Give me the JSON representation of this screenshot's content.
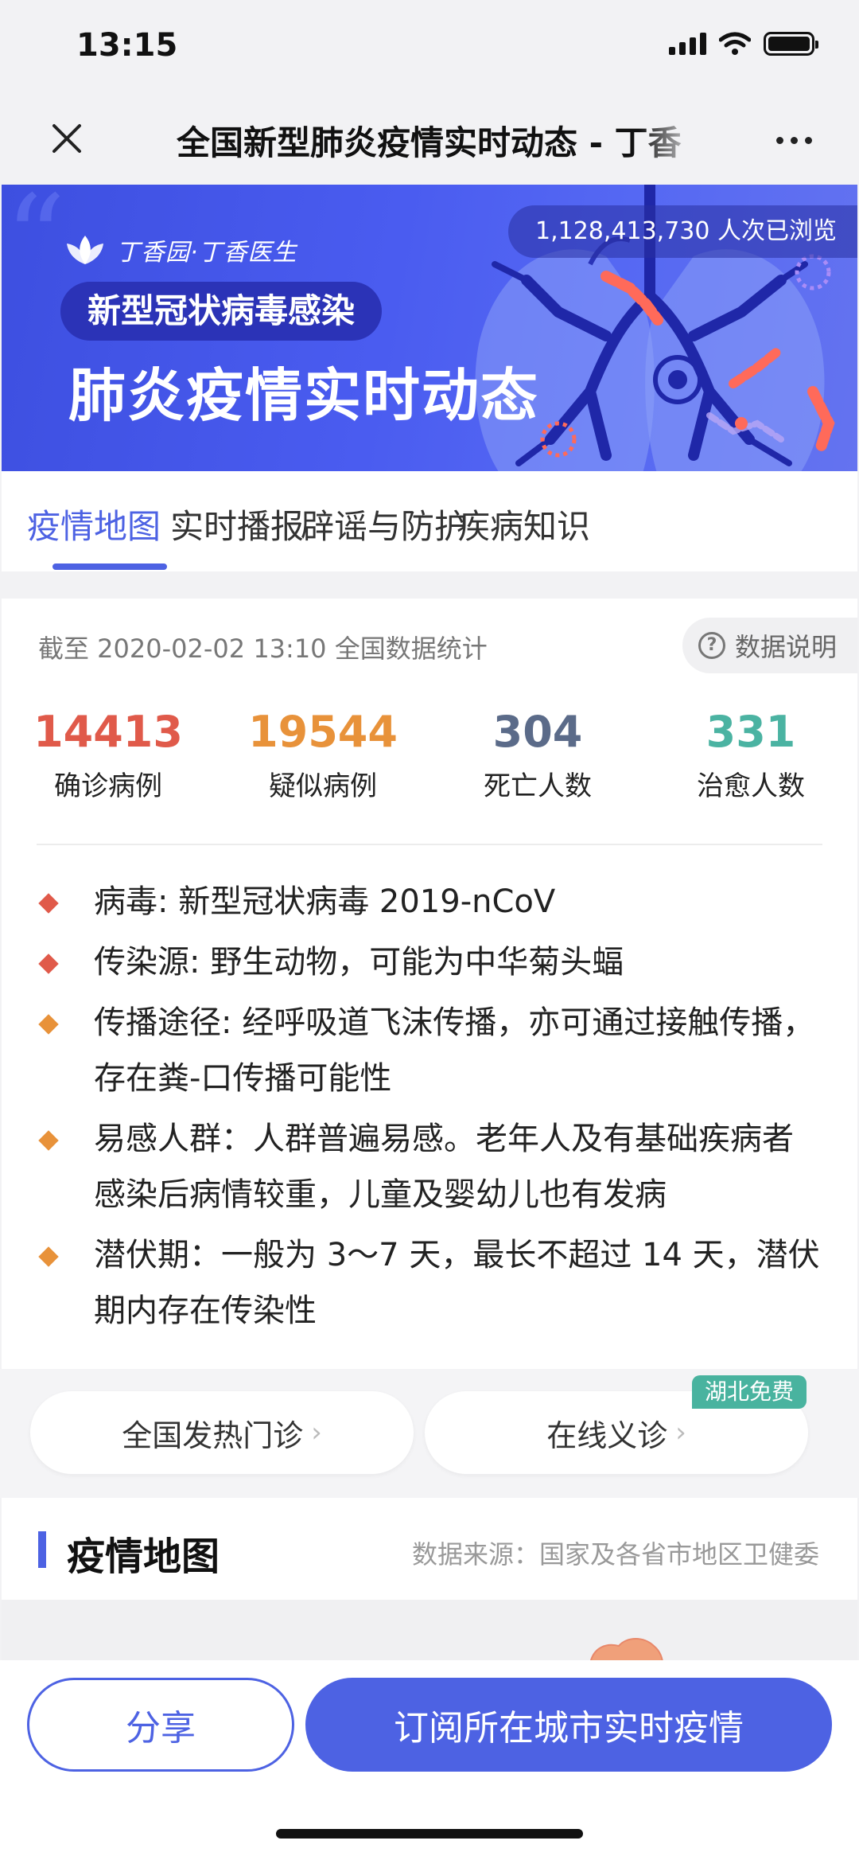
{
  "status_bar": {
    "time": "13:15"
  },
  "nav": {
    "title": "全国新型肺炎疫情实时动态 - 丁香"
  },
  "banner": {
    "brand": "丁香园·丁香医生",
    "views": "1,128,413,730 人次已浏览",
    "tag": "新型冠状病毒感染",
    "title": "肺炎疫情实时动态"
  },
  "tabs": [
    {
      "label": "疫情地图",
      "active": true
    },
    {
      "label": "实时播报",
      "active": false
    },
    {
      "label": "辟谣与防护",
      "active": false
    },
    {
      "label": "疾病知识",
      "active": false
    }
  ],
  "stats": {
    "as_of": "截至 2020-02-02 13:10 全国数据统计",
    "data_note": "数据说明",
    "items": [
      {
        "value": "14413",
        "label": "确诊病例",
        "color": "#e05a4a"
      },
      {
        "value": "19544",
        "label": "疑似病例",
        "color": "#e8923a"
      },
      {
        "value": "304",
        "label": "死亡人数",
        "color": "#5b6b89"
      },
      {
        "value": "331",
        "label": "治愈人数",
        "color": "#4bb3a2"
      }
    ]
  },
  "info": [
    {
      "text": "病毒: 新型冠状病毒 2019-nCoV",
      "color": "#e05a4a"
    },
    {
      "text": "传染源: 野生动物，可能为中华菊头蝠",
      "color": "#e05a4a"
    },
    {
      "text": "传播途径: 经呼吸道飞沫传播，亦可通过接触传播，存在粪-口传播可能性",
      "color": "#e8923a"
    },
    {
      "text": "易感人群：人群普遍易感。老年人及有基础疾病者感染后病情较重，儿童及婴幼儿也有发病",
      "color": "#e8923a"
    },
    {
      "text": "潜伏期：一般为 3～7 天，最长不超过 14 天，潜伏期内存在传染性",
      "color": "#e8923a"
    }
  ],
  "actions": {
    "fever_clinic": "全国发热门诊",
    "online_consult": "在线义诊",
    "free_badge": "湖北免费"
  },
  "map_section": {
    "title": "疫情地图",
    "source": "数据来源：国家及各省市地区卫健委"
  },
  "bottom": {
    "share": "分享",
    "subscribe": "订阅所在城市实时疫情"
  }
}
